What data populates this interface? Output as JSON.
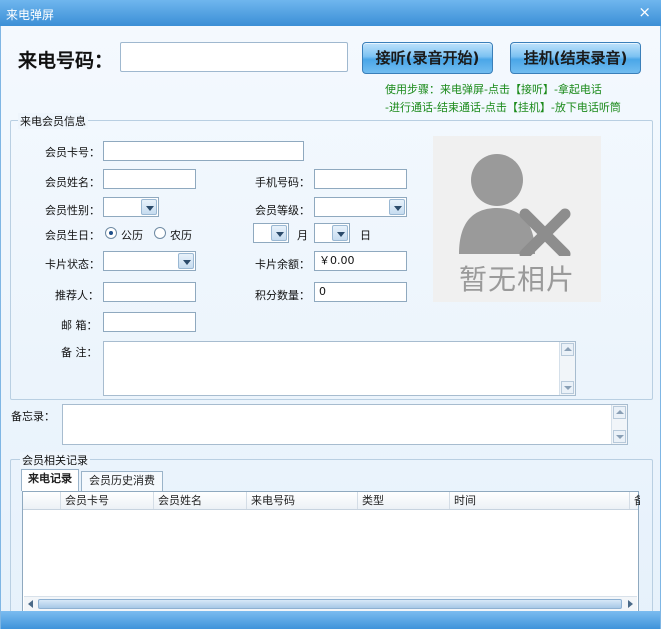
{
  "window": {
    "title": "来电弹屏",
    "close_glyph": "×"
  },
  "caller": {
    "label": "来电号码：",
    "value": "",
    "answer_button": "接听(录音开始)",
    "hangup_button": "挂机(结束录音)",
    "hint_line1": "使用步骤：来电弹屏-点击【接听】-拿起电话",
    "hint_line2": "-进行通话-结束通话-点击【挂机】-放下电话听筒"
  },
  "member_info": {
    "legend": "来电会员信息",
    "card_no_label": "会员卡号：",
    "card_no_value": "",
    "name_label": "会员姓名：",
    "name_value": "",
    "mobile_label": "手机号码：",
    "mobile_value": "",
    "gender_label": "会员性别：",
    "gender_value": "",
    "level_label": "会员等级：",
    "level_value": "",
    "birthday_label": "会员生日：",
    "calendar_solar": "公历",
    "calendar_lunar": "农历",
    "calendar_selected": "公历",
    "month_suffix": "月",
    "day_suffix": "日",
    "card_status_label": "卡片状态：",
    "card_status_value": "",
    "card_balance_label": "卡片余额：",
    "card_balance_value": "￥0.00",
    "referrer_label": "推荐人：",
    "referrer_value": "",
    "points_label": "积分数量：",
    "points_value": "0",
    "email_label": "邮  箱：",
    "email_value": "",
    "remark_label": "备  注：",
    "remark_value": "",
    "photo_placeholder": "暂无相片",
    "photo_icon": "user-remove-icon"
  },
  "memo": {
    "label": "备忘录：",
    "value": ""
  },
  "records": {
    "legend": "会员相关记录",
    "tabs": [
      "来电记录",
      "会员历史消费"
    ],
    "active_tab": "来电记录",
    "columns": [
      "会员卡号",
      "会员姓名",
      "来电号码",
      "类型",
      "时间",
      "备"
    ],
    "rows": []
  },
  "colors": {
    "title_bar": "#3b8fd6",
    "hint_green": "#1a8a1a",
    "button_blue": "#4aa6e8"
  }
}
